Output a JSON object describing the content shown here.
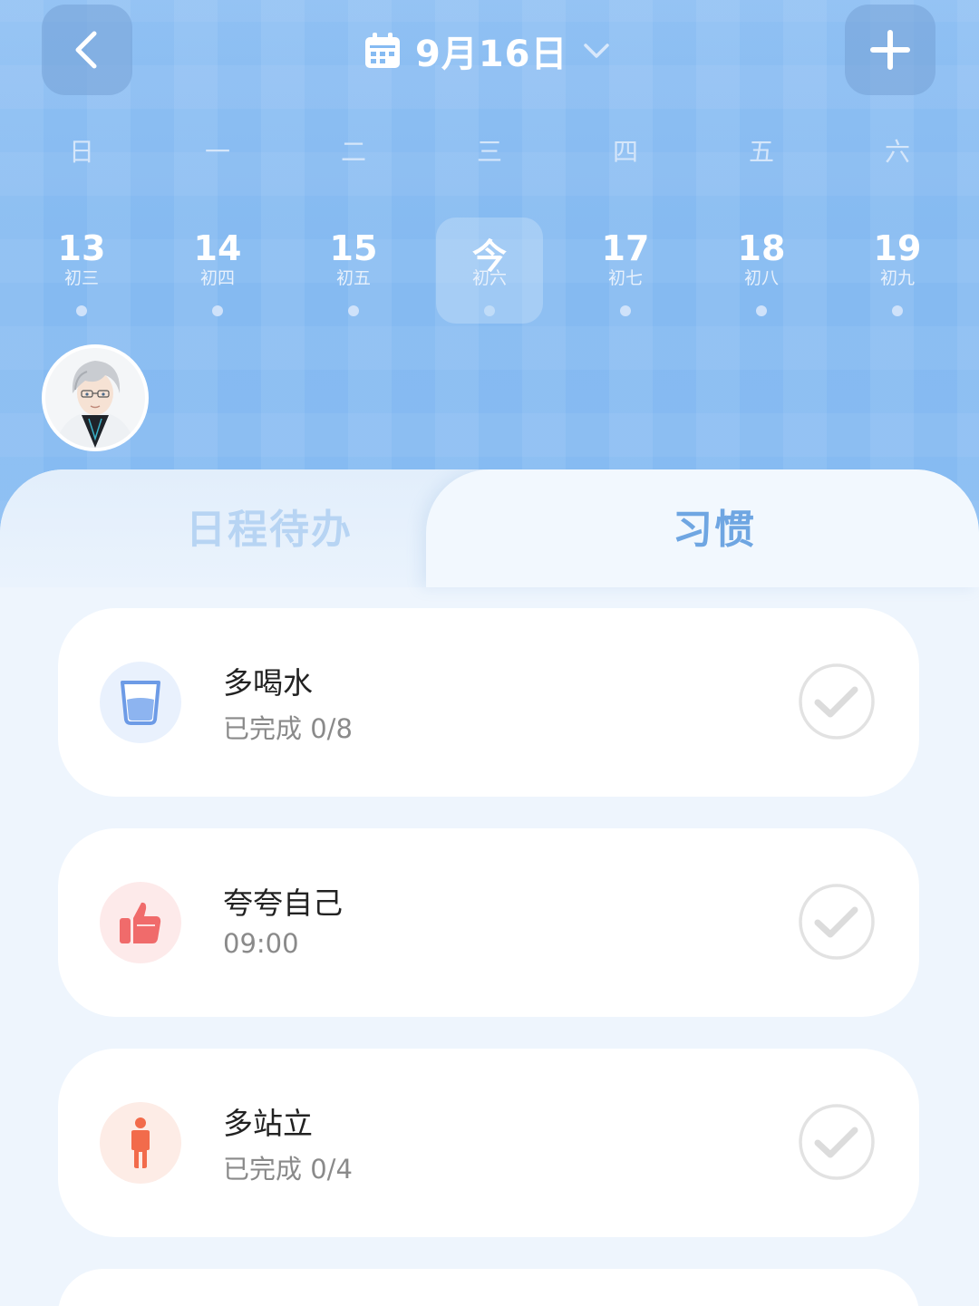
{
  "header": {
    "date_label": "9月16日",
    "weekdays": [
      "日",
      "一",
      "二",
      "三",
      "四",
      "五",
      "六"
    ],
    "days": [
      {
        "num": "13",
        "lunar": "初三"
      },
      {
        "num": "14",
        "lunar": "初四"
      },
      {
        "num": "15",
        "lunar": "初五"
      },
      {
        "num": "今",
        "lunar": "初六"
      },
      {
        "num": "17",
        "lunar": "初七"
      },
      {
        "num": "18",
        "lunar": "初八"
      },
      {
        "num": "19",
        "lunar": "初九"
      }
    ]
  },
  "tabs": {
    "schedule": "日程待办",
    "habits": "习惯"
  },
  "habits": [
    {
      "title": "多喝水",
      "sub": "已完成 0/8",
      "icon": "water-cup-icon",
      "color": "#5b8fe6"
    },
    {
      "title": "夸夸自己",
      "sub": "09:00",
      "icon": "thumbs-up-icon",
      "color": "#f06b6b"
    },
    {
      "title": "多站立",
      "sub": "已完成 0/4",
      "icon": "standing-person-icon",
      "color": "#f26b4b"
    }
  ],
  "colors": {
    "header_bg": "#86bbf2",
    "active_tab": "#6fa6e2",
    "inactive_tab": "#b7d4f3"
  }
}
